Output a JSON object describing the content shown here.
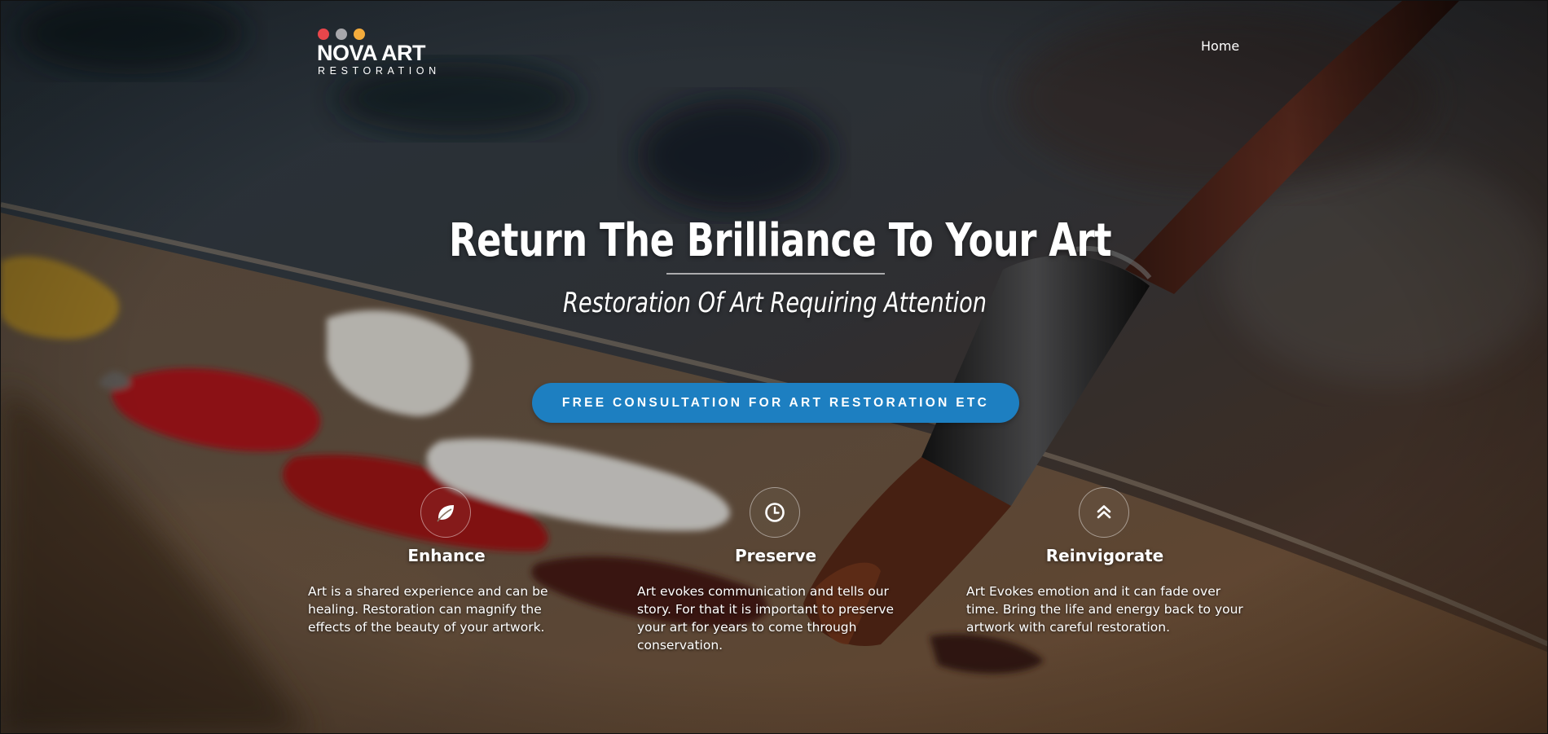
{
  "brand": {
    "name": "NOVA ART",
    "tagline": "RESTORATION",
    "dot_colors": [
      "#e9464b",
      "#a7a7ab",
      "#f4ac3c"
    ]
  },
  "nav": {
    "home_label": "Home"
  },
  "hero": {
    "headline": "Return The Brilliance To Your Art",
    "subheadline": "Restoration Of Art Requiring Attention",
    "cta_label": "FREE CONSULTATION FOR ART RESTORATION ETC",
    "background_image": "painter-palette-and-brush-icon"
  },
  "features": [
    {
      "icon": "leaf-icon",
      "title": "Enhance",
      "description": "Art is a shared experience and can be healing. Restoration can magnify the effects of the beauty of your artwork."
    },
    {
      "icon": "clock-icon",
      "title": "Preserve",
      "description": "Art evokes communication and tells our story. For that it is important to preserve your art for years to come through conservation."
    },
    {
      "icon": "double-chevron-up-icon",
      "title": "Reinvigorate",
      "description": "Art Evokes emotion and it can fade over time. Bring the life and energy back to your artwork with careful restoration."
    }
  ],
  "colors": {
    "cta_background": "#1d7fc1",
    "text": "#ffffff"
  }
}
